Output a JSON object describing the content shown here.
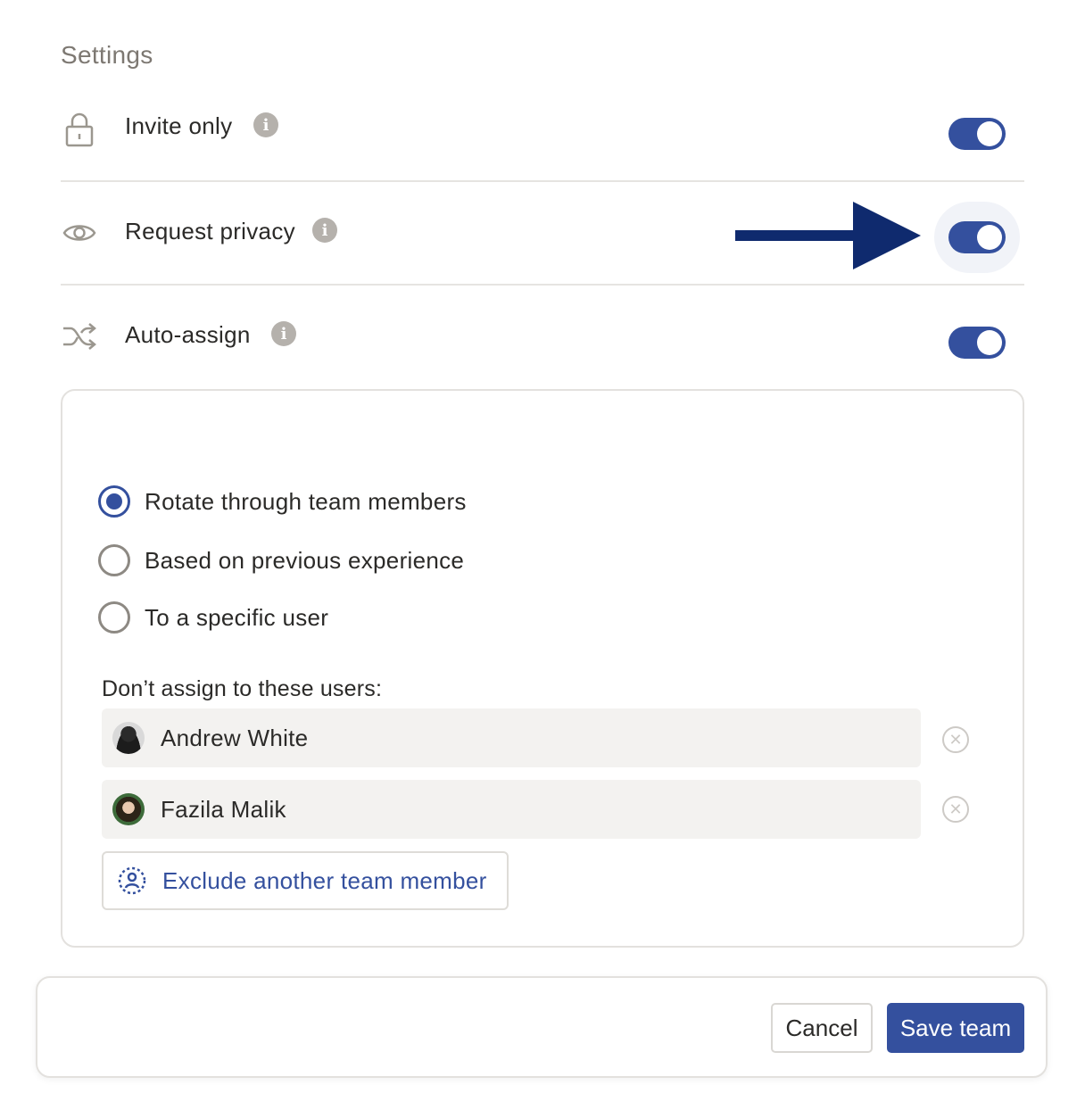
{
  "settings": {
    "title": "Settings",
    "rows": [
      {
        "label": "Invite only",
        "icon": "lock-icon",
        "enabled": true
      },
      {
        "label": "Request privacy",
        "icon": "eye-icon",
        "enabled": true
      },
      {
        "label": "Auto-assign",
        "icon": "shuffle-icon",
        "enabled": true
      }
    ]
  },
  "auto_assign": {
    "options": [
      {
        "label": "Rotate through team members",
        "selected": true
      },
      {
        "label": "Based on previous experience",
        "selected": false
      },
      {
        "label": "To a specific user",
        "selected": false
      }
    ],
    "exclude_label": "Don’t assign to these users:",
    "excluded_users": [
      {
        "name": "Andrew White"
      },
      {
        "name": "Fazila Malik"
      }
    ],
    "add_button_label": "Exclude another team member"
  },
  "footer": {
    "cancel_label": "Cancel",
    "save_label": "Save team"
  },
  "colors": {
    "accent": "#34509e",
    "annotation_arrow": "#0f2a6e"
  }
}
